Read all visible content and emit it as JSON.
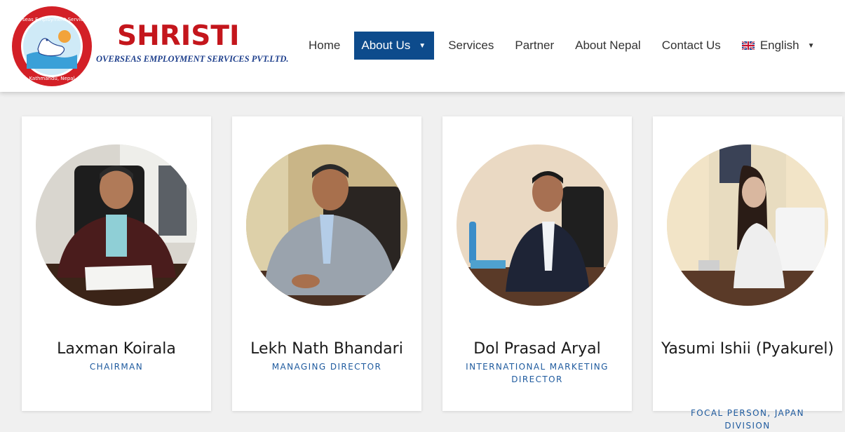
{
  "brand": {
    "name": "SHRISTI",
    "subtitle": "OVERSEAS EMPLOYMENT SERVICES PVT.LTD.",
    "seal_top_text": "Shristi Overseas Employment Services Pvt. Ltd.",
    "seal_bottom_text": "Kathmandu, Nepal"
  },
  "nav": {
    "items": [
      {
        "label": "Home"
      },
      {
        "label": "About Us"
      },
      {
        "label": "Services"
      },
      {
        "label": "Partner"
      },
      {
        "label": "About Nepal"
      },
      {
        "label": "Contact Us"
      }
    ],
    "language": "English",
    "active": "About Us"
  },
  "team": [
    {
      "name": "Laxman Koirala",
      "role": "CHAIRMAN"
    },
    {
      "name": "Lekh Nath Bhandari",
      "role": "MANAGING DIRECTOR"
    },
    {
      "name": "Dol Prasad Aryal",
      "role": "INTERNATIONAL MARKETING DIRECTOR"
    },
    {
      "name": "Yasumi Ishii (Pyakurel)",
      "role": "FOCAL PERSON, JAPAN DIVISION"
    }
  ],
  "colors": {
    "accent": "#0d4b8c",
    "brand_red": "#c4161c",
    "brand_blue": "#1e3f8c",
    "role_text": "#1e5a9e"
  }
}
